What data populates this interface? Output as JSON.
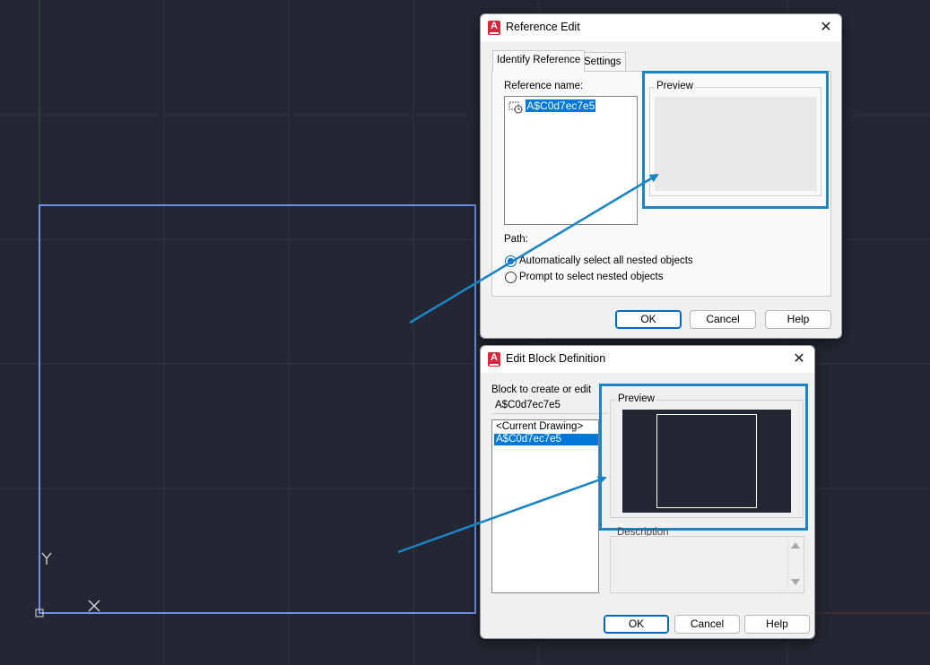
{
  "canvas": {
    "background": "#222733",
    "ucs": {
      "y_label": "Y",
      "x_label": "X"
    }
  },
  "reference_edit": {
    "title": "Reference Edit",
    "tabs": [
      "Identify Reference",
      "Settings"
    ],
    "reference_name_label": "Reference name:",
    "reference_item": "A$C0d7ec7e5",
    "preview_label": "Preview",
    "path_label": "Path:",
    "radio_options": [
      {
        "label": "Automatically select all nested objects",
        "checked": true
      },
      {
        "label": "Prompt to select nested objects",
        "checked": false
      }
    ],
    "buttons": {
      "ok": "OK",
      "cancel": "Cancel",
      "help": "Help"
    }
  },
  "edit_block": {
    "title": "Edit Block Definition",
    "block_label": "Block to create or edit",
    "block_value": "A$C0d7ec7e5",
    "list_items": [
      "<Current Drawing>",
      "A$C0d7ec7e5"
    ],
    "preview_label": "Preview",
    "description_label": "Description",
    "buttons": {
      "ok": "OK",
      "cancel": "Cancel",
      "help": "Help"
    }
  },
  "colors": {
    "highlight": "#1a84c4",
    "selection": "#0078d7",
    "block_outline": "#6e90e8"
  }
}
